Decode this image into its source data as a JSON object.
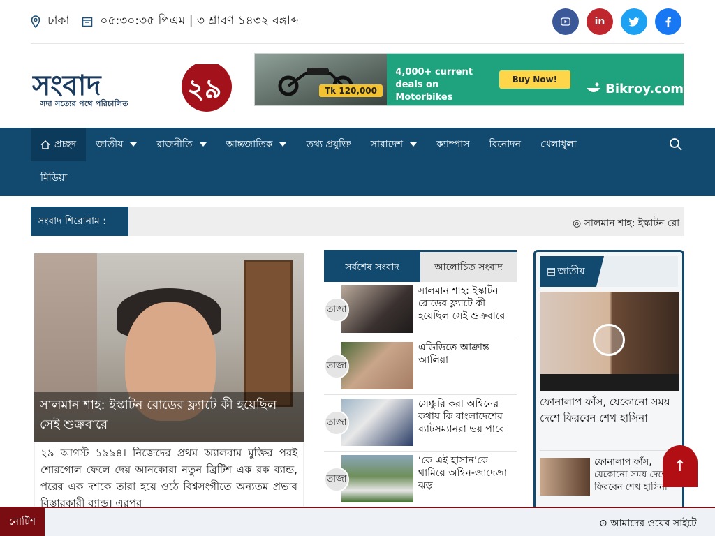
{
  "topbar": {
    "location": "ঢাকা",
    "datetime": "০৫:৩০:৩৫ পিএম | ৩ শ্রাবণ ১৪৩২ বঙ্গাব্দ",
    "social_icons": [
      "youtube-icon",
      "linkedin-icon",
      "twitter-icon",
      "facebook-icon"
    ],
    "social_colors": [
      "#3b5998",
      "#c0262d",
      "#1da1f2",
      "#1877f2"
    ]
  },
  "logo": {
    "name": "সংবাদ২৯",
    "tagline": "সদা সত্যের পথে পরিচালিত"
  },
  "ad": {
    "price": "Tk 120,000",
    "headline": "4,000+ current deals on Motorbikes",
    "cta": "Buy Now!",
    "brand": "Bikroy.com"
  },
  "nav": {
    "items": [
      {
        "label": "প্রচ্ছদ",
        "active": true,
        "dropdown": false
      },
      {
        "label": "জাতীয়",
        "active": false,
        "dropdown": true
      },
      {
        "label": "রাজনীতি",
        "active": false,
        "dropdown": true
      },
      {
        "label": "আন্তজাতিক",
        "active": false,
        "dropdown": true
      },
      {
        "label": "তথ্য প্রযুক্তি",
        "active": false,
        "dropdown": false
      },
      {
        "label": "সারাদেশ",
        "active": false,
        "dropdown": true
      },
      {
        "label": "ক্যাম্পাস",
        "active": false,
        "dropdown": false
      },
      {
        "label": "বিনোদন",
        "active": false,
        "dropdown": false
      },
      {
        "label": "খেলাধুলা",
        "active": false,
        "dropdown": false
      },
      {
        "label": "মিডিয়া",
        "active": false,
        "dropdown": false
      }
    ]
  },
  "ticker": {
    "label": "সংবাদ শিরোনাম :",
    "text": "সালমান শাহ: ইস্কাটন রো"
  },
  "lead": {
    "title": "সালমান শাহ: ইস্কাটন রোডের ফ্ল্যাটে কী হয়েছিল সেই শুক্রবারে",
    "excerpt": "২৯ আগস্ট ১৯৯৪। নিজেদের প্রথম অ্যালবাম মুক্তির পরই শোরগোল ফেলে দেয় আনকোরা নতুন ব্রিটিশ এক রক ব্যান্ড, পরের এক দশকে তারা হয়ে ওঠে বিশ্বসংগীতে অন্যতম প্রভাব বিস্তারকারী ব্যান্ড। এরপর"
  },
  "tabs": {
    "latest": "সর্বশেষ সংবাদ",
    "popular": "আলোচিত সংবাদ"
  },
  "news": [
    {
      "badge": "তাজা",
      "title": "সালমান শাহ: ইস্কাটন রোডের ফ্ল্যাটে কী হয়েছিল সেই শুক্রবারে"
    },
    {
      "badge": "তাজা",
      "title": "এডিডিতে আক্রান্ত আলিয়া"
    },
    {
      "badge": "তাজা",
      "title": "সেঞ্চুরি করা অশ্বিনের কথায় কি বাংলাদেশের ব্যাটসম্যানরা ভয় পাবে"
    },
    {
      "badge": "তাজা",
      "title": "‘কে এই হাসান’কে থামিয়ে অশ্বিন-জাদেজা ঝড়"
    }
  ],
  "side": {
    "category": "জাতীয়",
    "title": "ফোনালাপ ফাঁস, যেকোনো সময় দেশে ফিরবেন শেখ হাসিনা",
    "small_title": "ফোনালাপ ফাঁস, যেকোনো সময় দেশে ফিরবেন শেখ হাসিনা"
  },
  "notice": {
    "label": "নোটিশ",
    "text": "আমাদের ওয়েব সাইটে"
  },
  "colors": {
    "primary": "#124a6f",
    "accent": "#b10f14"
  }
}
